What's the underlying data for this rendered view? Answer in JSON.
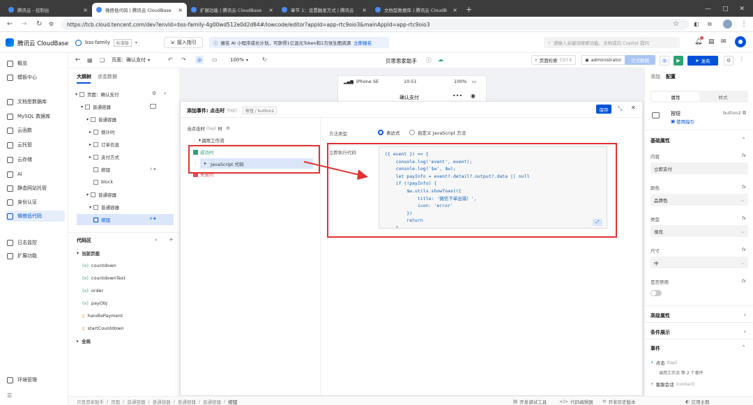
{
  "browser": {
    "tabs": [
      {
        "label": "腾讯云 - 控制台",
        "active": false
      },
      {
        "label": "微搭低代码 | 腾讯云 CloudBase",
        "active": true
      },
      {
        "label": "扩展功能 | 腾讯云 CloudBase",
        "active": false
      },
      {
        "label": "章节 1：设置触发方式 | 腾讯云",
        "active": false
      },
      {
        "label": "文档型数据库 | 腾讯云 CloudB",
        "active": false
      }
    ],
    "url": "https://tcb.cloud.tencent.com/dev?envId=bss-family-4g00wd512e0d2d84#/lowcode/editor?appId=app-rtc9oio3&mainAppId=app-rtc9oio3"
  },
  "header": {
    "brand": "腾讯云 CloudBase",
    "env_name": "bss-family",
    "env_plan": "标准版",
    "guide": "接入指引",
    "promo": "报名 AI 小程序成长计划，可获得1亿混元Token和1万张生图资源",
    "promo_link": "立即报名",
    "search_placeholder": "请输入关键词搜索功能、文档或向 Copilot 提问"
  },
  "leftnav": {
    "items": [
      {
        "label": "概览"
      },
      {
        "label": "模板中心"
      },
      {
        "label": "文档型数据库"
      },
      {
        "label": "MySQL 数据库"
      },
      {
        "label": "云函数"
      },
      {
        "label": "云托管"
      },
      {
        "label": "云存储"
      },
      {
        "label": "AI"
      },
      {
        "label": "静态网站托管"
      },
      {
        "label": "身份认证"
      },
      {
        "label": "微搭低代码",
        "active": true
      },
      {
        "label": "日志监控"
      },
      {
        "label": "扩展功能"
      }
    ],
    "footer": "环境管理"
  },
  "editor_toolbar": {
    "page_label": "页面：确认支付",
    "zoom": "100%",
    "app_name": "贝思思家助手",
    "page_search": "页面检索",
    "shortcut": "Ctrl K",
    "user": "administrator",
    "release_btn": "正式数据",
    "publish_btn": "发布"
  },
  "outline": {
    "tabs": [
      "大纲树",
      "状态数据"
    ],
    "tree": [
      {
        "label": "页面：确认支付",
        "indent": 0
      },
      {
        "label": "普通容器",
        "indent": 1
      },
      {
        "label": "普通容器",
        "indent": 2
      },
      {
        "label": "倒计时",
        "indent": 3
      },
      {
        "label": "订单信息",
        "indent": 3
      },
      {
        "label": "支付方式",
        "indent": 3
      },
      {
        "label": "按钮",
        "indent": 3
      },
      {
        "label": "block",
        "indent": 3
      },
      {
        "label": "普通容器",
        "indent": 2
      },
      {
        "label": "普通容器",
        "indent": 3
      },
      {
        "label": "按钮",
        "indent": 4,
        "selected": true
      }
    ],
    "code_title": "代码区",
    "current_page": "当前页面",
    "code_items": [
      {
        "label": "countdown",
        "kind": "var"
      },
      {
        "label": "countdownText",
        "kind": "var"
      },
      {
        "label": "order",
        "kind": "var"
      },
      {
        "label": "payObj",
        "kind": "var"
      },
      {
        "label": "handlePayment",
        "kind": "fn"
      },
      {
        "label": "startCountdown",
        "kind": "fn"
      }
    ],
    "global": "全局"
  },
  "phone": {
    "carrier": "iPhone SE",
    "time": "10:51",
    "battery": "100%",
    "title": "确认支付"
  },
  "event_panel": {
    "title": "添加事件: 点击时",
    "title_sub": "(tap)",
    "target": "按钮 / button2",
    "save": "保存",
    "trigger_label": "当点击时",
    "trigger_sub": "(tap)",
    "trigger_suffix": "时",
    "flow": "调用工作流",
    "success": "成功时",
    "js_code": "JavaScript 代码",
    "fail": "失败时",
    "method_type_label": "方法类型",
    "opt_expr": "表达式",
    "opt_custom": "自定义 JavaScript 方法",
    "exec_code_label": "立即执行代码",
    "code_lines": [
      "({ event }) => {",
      "    console.log('event', event);",
      "    console.log('$w', $w);",
      "    let payInfo = event?.detail?.output?.data || null",
      "    if (!payInfo) {",
      "        $w.utils.showToast({",
      "            title: '微信下单出错！',",
      "            icon: 'error'",
      "        })",
      "        return",
      "    }"
    ]
  },
  "right_panel": {
    "tabs": [
      "添加",
      "配置"
    ],
    "subtabs": [
      "属性",
      "样式"
    ],
    "component": "按钮",
    "component_id": "button2",
    "guide": "使用指引",
    "basic_props": "基础属性",
    "content_label": "内容",
    "content_value": "立即支付",
    "color_label": "颜色",
    "color_value": "品牌色",
    "type_label": "类型",
    "type_value": "填充",
    "size_label": "尺寸",
    "size_value": "中",
    "disabled_label": "是否禁用",
    "advanced": "高级属性",
    "condition": "条件展示",
    "events": "事件",
    "event1": "点击",
    "event1_sub": "(tap)",
    "event1_desc": "调用工作流 等 2 个事件",
    "event2": "客服会话",
    "event2_sub": "(contact)"
  },
  "footer": {
    "breadcrumb": [
      "贝思思家助手",
      "页面",
      "普通容器",
      "普通容器",
      "普通容器",
      "普通容器",
      "按钮"
    ],
    "devtools": "开发调试工具",
    "code_editor": "代码编辑器",
    "history": "开发历史版本",
    "theme": "应用主题"
  },
  "colors": {
    "brand": "#0052d9",
    "annotation": "#e03131",
    "selected_bg": "#dbe6fb"
  }
}
